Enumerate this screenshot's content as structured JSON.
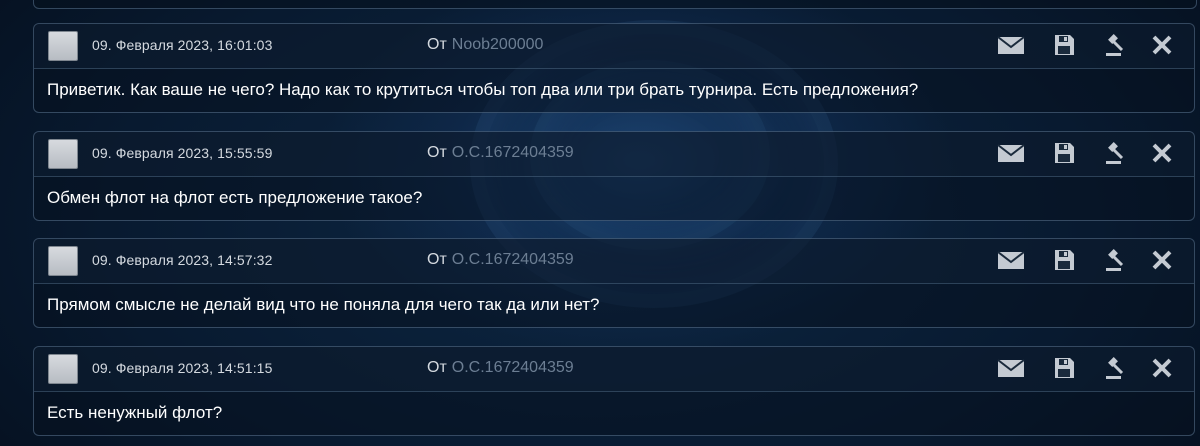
{
  "messages": [
    {
      "date": "09. Февраля 2023, 16:01:03",
      "from_label": "От",
      "sender": "Noob200000",
      "text": "Приветик. Как ваше не чего? Надо как то крутиться чтобы топ два или три брать турнира. Есть предложения?"
    },
    {
      "date": "09. Февраля 2023, 15:55:59",
      "from_label": "От",
      "sender": "O.C.1672404359",
      "text": "Обмен флот на флот есть предложение такое?"
    },
    {
      "date": "09. Февраля 2023, 14:57:32",
      "from_label": "От",
      "sender": "O.C.1672404359",
      "text": "Прямом смысле не делай вид что не поняла для чего так да или нет?"
    },
    {
      "date": "09. Февраля 2023, 14:51:15",
      "from_label": "От",
      "sender": "O.C.1672404359",
      "text": "Есть ненужный флот?"
    }
  ],
  "icons": {
    "reply": "mail-icon",
    "save": "save-icon",
    "report": "gavel-icon",
    "delete": "close-icon"
  },
  "colors": {
    "text": "#ffffff",
    "meta": "#d5dae0",
    "sender": "#6c7e93",
    "icon": "#c4cad2",
    "border": "#6e8caa"
  }
}
